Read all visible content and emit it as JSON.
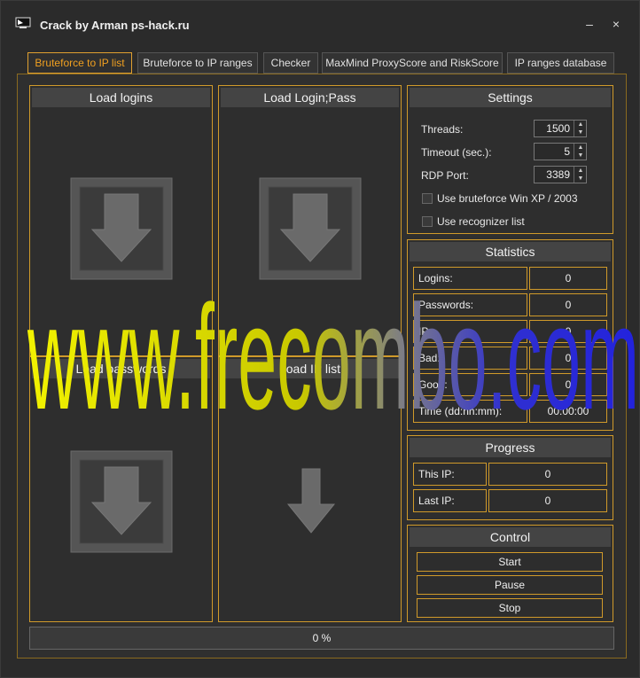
{
  "window": {
    "title": "Crack by Arman ps-hack.ru",
    "minimize_glyph": "–",
    "close_glyph": "×"
  },
  "tabs": [
    {
      "label": "Bruteforce to IP list",
      "active": true
    },
    {
      "label": "Bruteforce to IP ranges",
      "active": false
    },
    {
      "label": "Checker",
      "active": false
    },
    {
      "label": "MaxMind ProxyScore and RiskScore",
      "active": false
    },
    {
      "label": "IP ranges database",
      "active": false
    }
  ],
  "panels": {
    "load_logins": "Load logins",
    "load_login_pass": "Load Login;Pass",
    "load_passwords": "Load passwords",
    "load_ip_list": "Load IP list"
  },
  "settings": {
    "title": "Settings",
    "threads_label": "Threads:",
    "threads_value": "1500",
    "timeout_label": "Timeout (sec.):",
    "timeout_value": "5",
    "rdp_port_label": "RDP Port:",
    "rdp_port_value": "3389",
    "winxp_label": "Use bruteforce Win XP / 2003",
    "winxp_checked": false,
    "recognizer_label": "Use recognizer list",
    "recognizer_checked": false
  },
  "statistics": {
    "title": "Statistics",
    "rows": [
      {
        "label": "Logins:",
        "value": "0"
      },
      {
        "label": "Passwords:",
        "value": "0"
      },
      {
        "label": "IP:",
        "value": "0"
      },
      {
        "label": "Bad:",
        "value": "0"
      },
      {
        "label": "Good:",
        "value": "0"
      },
      {
        "label": "Time (dd:hh:mm):",
        "value": "00:00:00"
      }
    ]
  },
  "progress": {
    "title": "Progress",
    "this_ip_label": "This IP:",
    "this_ip_value": "0",
    "last_ip_label": "Last IP:",
    "last_ip_value": "0"
  },
  "control": {
    "title": "Control",
    "start": "Start",
    "pause": "Pause",
    "stop": "Stop"
  },
  "overall_progress": {
    "text": "0 %",
    "percent": 0
  },
  "watermark": "www.frecombo.com",
  "colors": {
    "accent": "#d09a2a",
    "active_tab_text": "#f0a020",
    "watermark_yellow": "#f2f200",
    "watermark_blue": "#2222dd"
  }
}
